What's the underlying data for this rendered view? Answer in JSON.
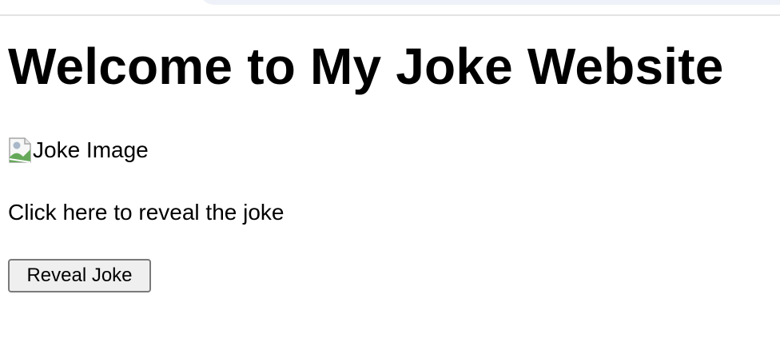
{
  "page": {
    "title": "Welcome to My Joke Website",
    "image_alt": "Joke Image",
    "reveal_text": "Click here to reveal the joke",
    "button_label": "Reveal Joke"
  },
  "icons": {
    "broken_image": "broken-image-icon"
  },
  "colors": {
    "background": "#ffffff",
    "text": "#000000",
    "button_background": "#efefef",
    "button_border": "#7a7a7a"
  }
}
